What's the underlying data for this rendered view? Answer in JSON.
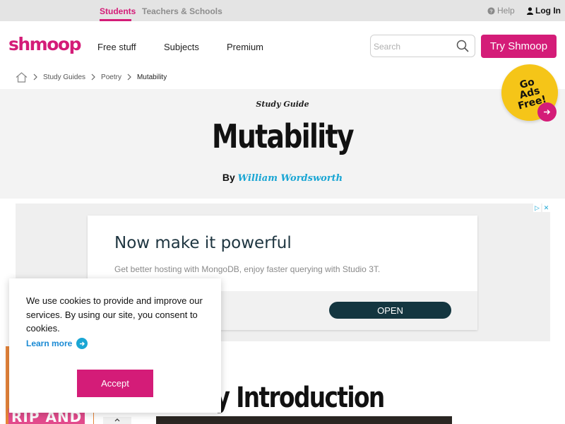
{
  "topbar": {
    "students": "Students",
    "teachers": "Teachers & Schools",
    "help": "Help",
    "login": "Log In"
  },
  "header": {
    "logo": "shmoop",
    "nav": {
      "free_stuff": "Free stuff",
      "subjects": "Subjects",
      "premium": "Premium"
    },
    "search_placeholder": "Search",
    "try_button": "Try Shmoop"
  },
  "breadcrumb": {
    "items": [
      "Study Guides",
      "Poetry"
    ],
    "current": "Mutability"
  },
  "ads_free_badge": {
    "line1": "Go",
    "line2": "Ads Free!"
  },
  "hero": {
    "label": "Study Guide",
    "title": "Mutability",
    "by": "By",
    "author": "William Wordsworth"
  },
  "ad": {
    "title": "Now make it powerful",
    "text": "Get better hosting with MongoDB, enjoy faster querying with Studio 3T.",
    "button": "OPEN"
  },
  "content": {
    "intro_heading_visible": "bility Introduction",
    "promo_text": "RIP AND"
  },
  "cookie": {
    "text": "We use cookies to provide and improve our services. By using our site, you consent to cookies.",
    "learn_more": "Learn more",
    "accept": "Accept"
  },
  "colors": {
    "brand": "#d41c78",
    "author_link": "#1aa6d4",
    "badge": "#f5c518",
    "ad_button": "#143640"
  },
  "icons": [
    "help-circle-icon",
    "user-icon",
    "search-icon",
    "home-icon",
    "chevron-right-icon",
    "arrow-right-icon",
    "adchoices-icon",
    "chevron-up-icon"
  ]
}
